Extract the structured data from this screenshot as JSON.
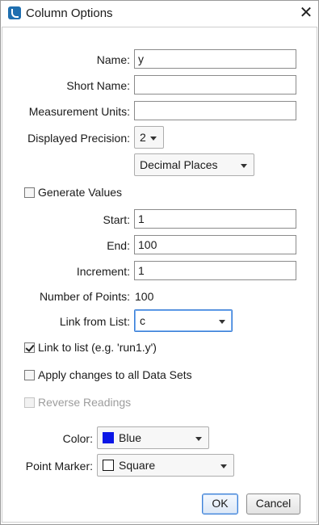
{
  "window": {
    "title": "Column Options"
  },
  "icons": {
    "app": "app-logo-icon",
    "close": "close-icon"
  },
  "fields": {
    "name": {
      "label": "Name:",
      "value": "y"
    },
    "short_name": {
      "label": "Short Name:",
      "value": ""
    },
    "measurement_units": {
      "label": "Measurement Units:",
      "value": ""
    },
    "displayed_precision": {
      "label": "Displayed Precision:",
      "value": "2"
    },
    "precision_mode": {
      "value": "Decimal Places"
    }
  },
  "generate_values": {
    "label": "Generate Values",
    "checked": false,
    "start": {
      "label": "Start:",
      "value": "1"
    },
    "end": {
      "label": "End:",
      "value": "100"
    },
    "increment": {
      "label": "Increment:",
      "value": "1"
    },
    "number_of_points": {
      "label": "Number of Points:",
      "value": "100"
    }
  },
  "link_from_list": {
    "label": "Link from List:",
    "value": "c"
  },
  "link_to_list": {
    "label": "Link to list (e.g. 'run1.y')",
    "checked": true
  },
  "apply_all": {
    "label": "Apply changes to all Data Sets",
    "checked": false
  },
  "reverse_readings": {
    "label": "Reverse Readings",
    "checked": false,
    "disabled": true
  },
  "color": {
    "label": "Color:",
    "value": "Blue",
    "swatch": "#0a16e6"
  },
  "point_marker": {
    "label": "Point Marker:",
    "value": "Square"
  },
  "buttons": {
    "ok": "OK",
    "cancel": "Cancel"
  }
}
